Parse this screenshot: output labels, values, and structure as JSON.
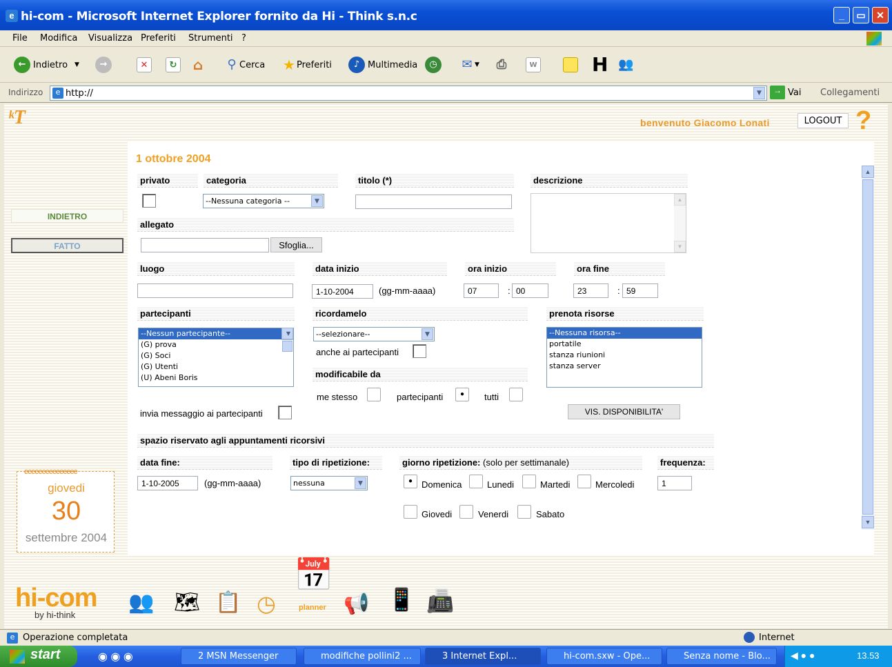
{
  "window": {
    "title": "hi-com - Microsoft Internet Explorer fornito da Hi - Think s.n.c"
  },
  "menu": [
    "File",
    "Modifica",
    "Visualizza",
    "Preferiti",
    "Strumenti",
    "?"
  ],
  "toolbar": {
    "back": "Indietro",
    "search": "Cerca",
    "favorites": "Preferiti",
    "media": "Multimedia"
  },
  "address": {
    "label": "Indirizzo",
    "value": "http://",
    "go": "Vai",
    "links": "Collegamenti"
  },
  "header": {
    "welcome": "benvenuto Giacomo Lonati",
    "logout": "LOGOUT",
    "help": "?"
  },
  "sidebar": {
    "back": "INDIETRO",
    "done": "FATTO"
  },
  "calendar": {
    "weekday": "giovedi",
    "day": "30",
    "month": "settembre 2004"
  },
  "form": {
    "date": "1 ottobre 2004",
    "private_label": "privato",
    "category_label": "categoria",
    "category_value": "--Nessuna categoria --",
    "title_label": "titolo (*)",
    "title_value": "",
    "description_label": "descrizione",
    "attachment_label": "allegato",
    "browse_button": "Sfoglia...",
    "place_label": "luogo",
    "start_date_label": "data inizio",
    "start_date_value": "1-10-2004",
    "date_format": "(gg-mm-aaaa)",
    "start_time_label": "ora inizio",
    "start_hour": "07",
    "start_min": "00",
    "end_time_label": "ora fine",
    "end_hour": "23",
    "end_min": "59",
    "colon": ":",
    "participants_label": "partecipanti",
    "participants": [
      "--Nessun partecipante--",
      "(G) prova",
      "(G) Soci",
      "(G) Utenti",
      "(U) Abeni Boris"
    ],
    "remind_label": "ricordamelo",
    "remind_value": "--selezionare--",
    "remind_participants": "anche ai partecipanti",
    "editable_label": "modificabile da",
    "editable_self": "me stesso",
    "editable_participants": "partecipanti",
    "editable_all": "tutti",
    "resources_label": "prenota risorse",
    "resources": [
      "--Nessuna risorsa--",
      "portatile",
      "stanza riunioni",
      "stanza server"
    ],
    "availability_button": "VIS. DISPONIBILITA'",
    "send_message": "invia messaggio ai partecipanti",
    "recurring_header": "spazio riservato agli appuntamenti ricorsivi",
    "end_date_label": "data fine:",
    "end_date_value": "1-10-2005",
    "repeat_type_label": "tipo di ripetizione:",
    "repeat_type_value": "nessuna",
    "repeat_day_label": "giorno ripetizione:",
    "repeat_day_note": "(solo per settimanale)",
    "days": [
      "Domenica",
      "Lunedi",
      "Martedi",
      "Mercoledi",
      "Giovedi",
      "Venerdi",
      "Sabato"
    ],
    "frequency_label": "frequenza:",
    "frequency_value": "1"
  },
  "footer": {
    "logo": "hi-com",
    "by": "by hi-think",
    "planner": "planner"
  },
  "status": {
    "text": "Operazione completata",
    "zone": "Internet"
  },
  "taskbar": {
    "start": "start",
    "tasks": [
      "2 MSN Messenger",
      "modifiche pollini2 ...",
      "3 Internet Expl...",
      "hi-com.sxw - Ope...",
      "Senza nome - Blo..."
    ],
    "clock": "13.53"
  }
}
